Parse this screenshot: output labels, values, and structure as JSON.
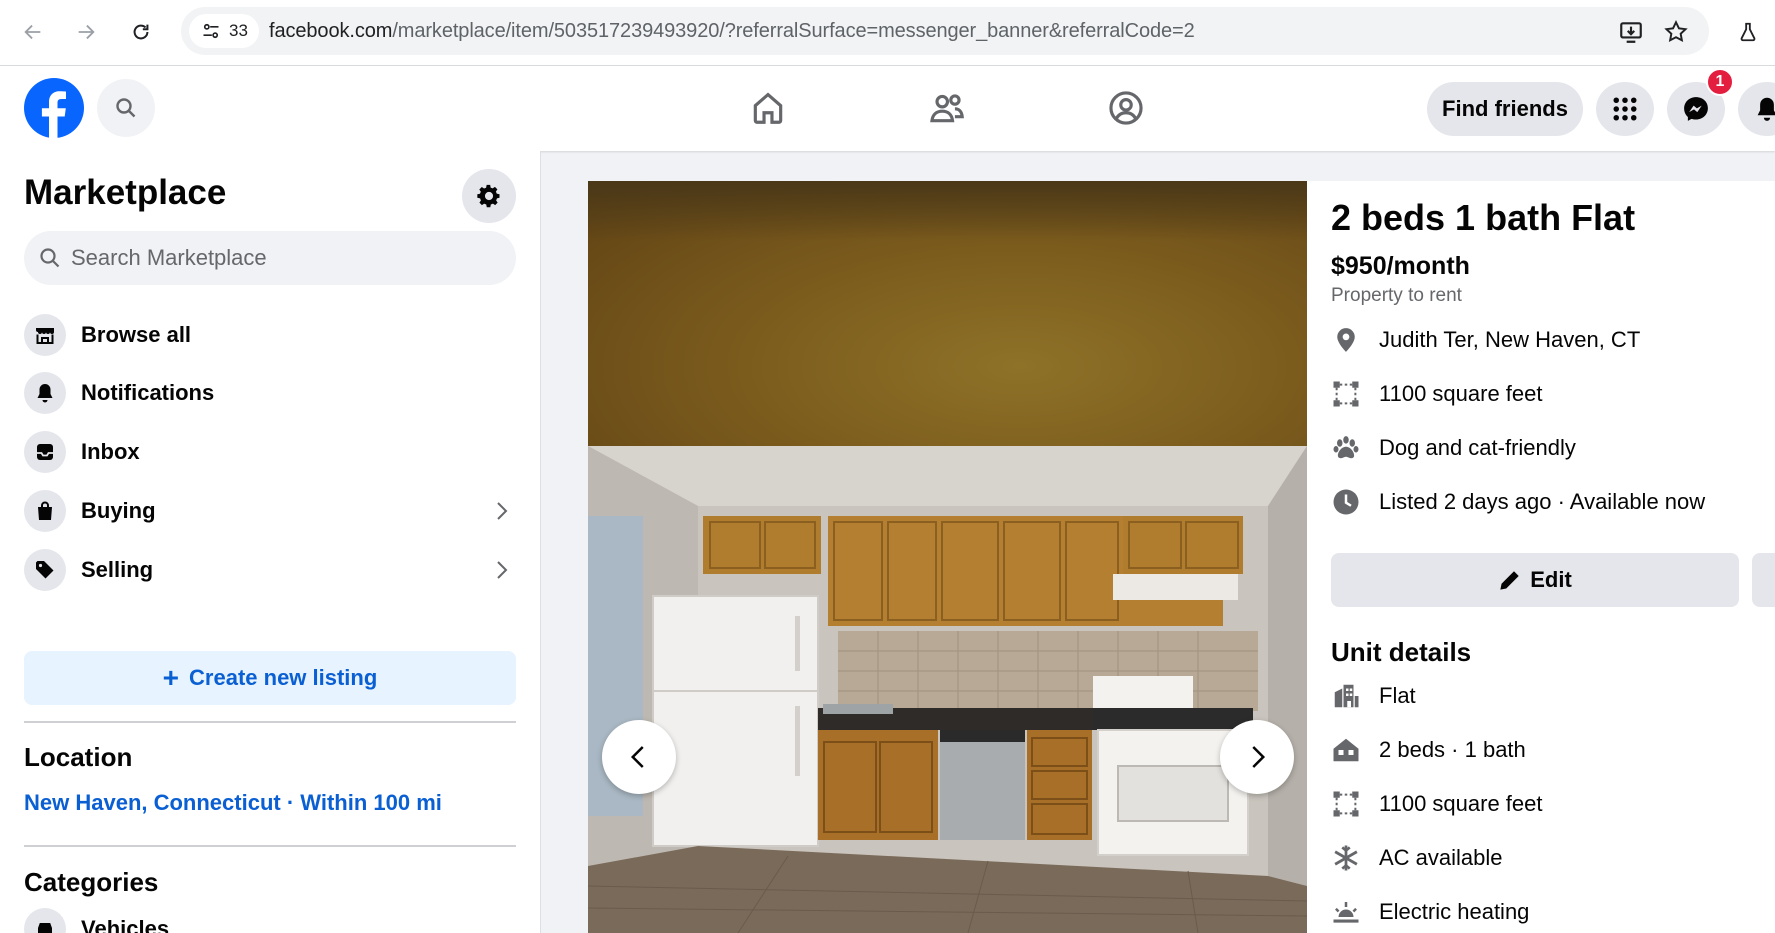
{
  "browser": {
    "site_info_count": "33",
    "url_domain": "facebook.com",
    "url_path": "/marketplace/item/503517239493920/?referralSurface=messenger_banner&referralCode=2"
  },
  "header": {
    "find_friends": "Find friends",
    "messenger_badge": "1"
  },
  "sidebar": {
    "title": "Marketplace",
    "search_placeholder": "Search Marketplace",
    "items": [
      {
        "label": "Browse all",
        "icon": "storefront-icon"
      },
      {
        "label": "Notifications",
        "icon": "bell-icon"
      },
      {
        "label": "Inbox",
        "icon": "inbox-icon"
      },
      {
        "label": "Buying",
        "icon": "shopping-bag-icon"
      },
      {
        "label": "Selling",
        "icon": "tag-icon"
      }
    ],
    "create_listing": "Create new listing",
    "location_title": "Location",
    "location_value": "New Haven, Connecticut · Within 100 mi",
    "categories_title": "Categories",
    "categories": [
      {
        "label": "Vehicles",
        "icon": "car-icon"
      }
    ]
  },
  "listing": {
    "title": "2 beds 1 bath Flat",
    "price": "$950/month",
    "subtitle": "Property to rent",
    "facts": [
      {
        "text": "Judith Ter, New Haven, CT",
        "icon": "location-pin-icon"
      },
      {
        "text": "1100 square feet",
        "icon": "square-footage-icon"
      },
      {
        "text": "Dog and cat-friendly",
        "icon": "paw-icon"
      },
      {
        "text": "Listed 2 days ago · Available now",
        "icon": "clock-icon"
      }
    ],
    "edit_label": "Edit",
    "unit_details_title": "Unit details",
    "unit_details": [
      {
        "text": "Flat",
        "icon": "building-icon"
      },
      {
        "text": "2 beds · 1 bath",
        "icon": "house-icon"
      },
      {
        "text": "1100 square feet",
        "icon": "square-footage-icon"
      },
      {
        "text": "AC available",
        "icon": "snowflake-icon"
      },
      {
        "text": "Electric heating",
        "icon": "heating-icon"
      }
    ]
  },
  "colors": {
    "fb_blue": "#0866ff",
    "link_blue": "#0a5fd3",
    "badge_red": "#e41e3f"
  }
}
